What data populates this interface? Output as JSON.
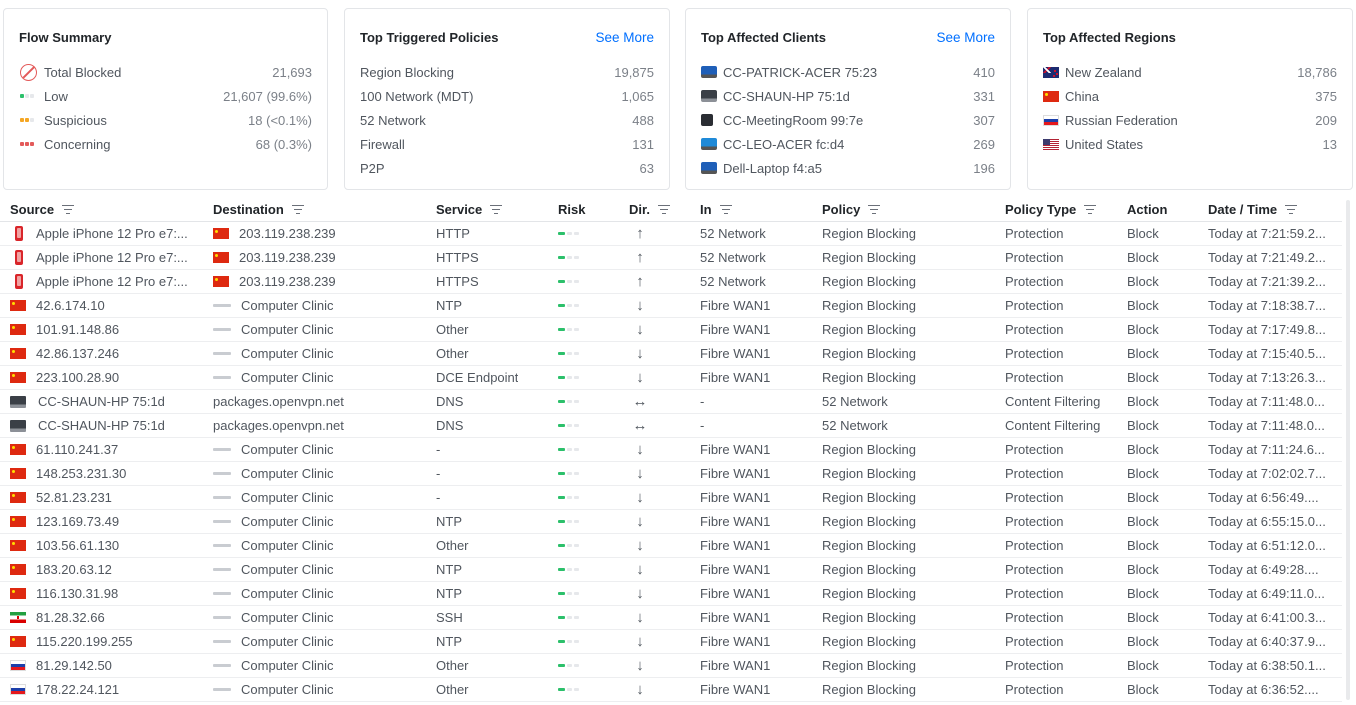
{
  "colors": {
    "accent": "#006fff",
    "low": "#2cc06b",
    "suspicious": "#f5a623",
    "concerning": "#e35a5a"
  },
  "flow_summary": {
    "title": "Flow Summary",
    "rows": [
      {
        "icon": "blocked-icon",
        "label": "Total Blocked",
        "value": "21,693"
      },
      {
        "icon": "low-risk-icon",
        "label": "Low",
        "value": "21,607 (99.6%)"
      },
      {
        "icon": "suspicious-risk-icon",
        "label": "Suspicious",
        "value": "18 (<0.1%)"
      },
      {
        "icon": "concerning-risk-icon",
        "label": "Concerning",
        "value": "68 (0.3%)"
      }
    ]
  },
  "top_policies": {
    "title": "Top Triggered Policies",
    "see_more": "See More",
    "rows": [
      {
        "label": "Region Blocking",
        "value": "19,875"
      },
      {
        "label": "100 Network (MDT)",
        "value": "1,065"
      },
      {
        "label": "52 Network",
        "value": "488"
      },
      {
        "label": "Firewall",
        "value": "131"
      },
      {
        "label": "P2P",
        "value": "63"
      }
    ]
  },
  "top_clients": {
    "title": "Top Affected Clients",
    "see_more": "See More",
    "rows": [
      {
        "icon": "laptop-icon",
        "label": "CC-PATRICK-ACER 75:23",
        "value": "410"
      },
      {
        "icon": "laptop-icon",
        "label": "CC-SHAUN-HP 75:1d",
        "value": "331"
      },
      {
        "icon": "pc-icon",
        "label": "CC-MeetingRoom 99:7e",
        "value": "307"
      },
      {
        "icon": "laptop-icon",
        "label": "CC-LEO-ACER fc:d4",
        "value": "269"
      },
      {
        "icon": "laptop-icon",
        "label": "Dell-Laptop f4:a5",
        "value": "196"
      }
    ]
  },
  "top_regions": {
    "title": "Top Affected Regions",
    "rows": [
      {
        "flag": "nz",
        "label": "New Zealand",
        "value": "18,786"
      },
      {
        "flag": "cn",
        "label": "China",
        "value": "375"
      },
      {
        "flag": "ru",
        "label": "Russian Federation",
        "value": "209"
      },
      {
        "flag": "us",
        "label": "United States",
        "value": "13"
      }
    ]
  },
  "table": {
    "headers": {
      "source": "Source",
      "destination": "Destination",
      "service": "Service",
      "risk": "Risk",
      "dir": "Dir.",
      "in": "In",
      "policy": "Policy",
      "policy_type": "Policy Type",
      "action": "Action",
      "datetime": "Date / Time"
    },
    "rows": [
      {
        "src_icon": "phone",
        "source": "Apple iPhone 12 Pro e7:...",
        "dst_icon": "cn",
        "destination": "203.119.238.239",
        "service": "HTTP",
        "risk": "low",
        "dir": "↑",
        "in": "52 Network",
        "policy": "Region Blocking",
        "policy_type": "Protection",
        "action": "Block",
        "datetime": "Today at 7:21:59.2..."
      },
      {
        "src_icon": "phone",
        "source": "Apple iPhone 12 Pro e7:...",
        "dst_icon": "cn",
        "destination": "203.119.238.239",
        "service": "HTTPS",
        "risk": "low",
        "dir": "↑",
        "in": "52 Network",
        "policy": "Region Blocking",
        "policy_type": "Protection",
        "action": "Block",
        "datetime": "Today at 7:21:49.2..."
      },
      {
        "src_icon": "phone",
        "source": "Apple iPhone 12 Pro e7:...",
        "dst_icon": "cn",
        "destination": "203.119.238.239",
        "service": "HTTPS",
        "risk": "low",
        "dir": "↑",
        "in": "52 Network",
        "policy": "Region Blocking",
        "policy_type": "Protection",
        "action": "Block",
        "datetime": "Today at 7:21:39.2..."
      },
      {
        "src_icon": "cn",
        "source": "42.6.174.10",
        "dst_icon": "router",
        "destination": "Computer Clinic",
        "service": "NTP",
        "risk": "low",
        "dir": "↓",
        "in": "Fibre WAN1",
        "policy": "Region Blocking",
        "policy_type": "Protection",
        "action": "Block",
        "datetime": "Today at 7:18:38.7..."
      },
      {
        "src_icon": "cn",
        "source": "101.91.148.86",
        "dst_icon": "router",
        "destination": "Computer Clinic",
        "service": "Other",
        "risk": "low",
        "dir": "↓",
        "in": "Fibre WAN1",
        "policy": "Region Blocking",
        "policy_type": "Protection",
        "action": "Block",
        "datetime": "Today at 7:17:49.8..."
      },
      {
        "src_icon": "cn",
        "source": "42.86.137.246",
        "dst_icon": "router",
        "destination": "Computer Clinic",
        "service": "Other",
        "risk": "low",
        "dir": "↓",
        "in": "Fibre WAN1",
        "policy": "Region Blocking",
        "policy_type": "Protection",
        "action": "Block",
        "datetime": "Today at 7:15:40.5..."
      },
      {
        "src_icon": "cn",
        "source": "223.100.28.90",
        "dst_icon": "router",
        "destination": "Computer Clinic",
        "service": "DCE Endpoint",
        "risk": "low",
        "dir": "↓",
        "in": "Fibre WAN1",
        "policy": "Region Blocking",
        "policy_type": "Protection",
        "action": "Block",
        "datetime": "Today at 7:13:26.3..."
      },
      {
        "src_icon": "laptop",
        "source": "CC-SHAUN-HP 75:1d",
        "dst_icon": "",
        "destination": "packages.openvpn.net",
        "service": "DNS",
        "risk": "low",
        "dir": "↔",
        "in": "-",
        "policy": "52 Network",
        "policy_type": "Content Filtering",
        "action": "Block",
        "datetime": "Today at 7:11:48.0..."
      },
      {
        "src_icon": "laptop",
        "source": "CC-SHAUN-HP 75:1d",
        "dst_icon": "",
        "destination": "packages.openvpn.net",
        "service": "DNS",
        "risk": "low",
        "dir": "↔",
        "in": "-",
        "policy": "52 Network",
        "policy_type": "Content Filtering",
        "action": "Block",
        "datetime": "Today at 7:11:48.0..."
      },
      {
        "src_icon": "cn",
        "source": "61.110.241.37",
        "dst_icon": "router",
        "destination": "Computer Clinic",
        "service": "-",
        "risk": "low",
        "dir": "↓",
        "in": "Fibre WAN1",
        "policy": "Region Blocking",
        "policy_type": "Protection",
        "action": "Block",
        "datetime": "Today at 7:11:24.6..."
      },
      {
        "src_icon": "cn",
        "source": "148.253.231.30",
        "dst_icon": "router",
        "destination": "Computer Clinic",
        "service": "-",
        "risk": "low",
        "dir": "↓",
        "in": "Fibre WAN1",
        "policy": "Region Blocking",
        "policy_type": "Protection",
        "action": "Block",
        "datetime": "Today at 7:02:02.7..."
      },
      {
        "src_icon": "cn",
        "source": "52.81.23.231",
        "dst_icon": "router",
        "destination": "Computer Clinic",
        "service": "-",
        "risk": "low",
        "dir": "↓",
        "in": "Fibre WAN1",
        "policy": "Region Blocking",
        "policy_type": "Protection",
        "action": "Block",
        "datetime": "Today at 6:56:49...."
      },
      {
        "src_icon": "cn",
        "source": "123.169.73.49",
        "dst_icon": "router",
        "destination": "Computer Clinic",
        "service": "NTP",
        "risk": "low",
        "dir": "↓",
        "in": "Fibre WAN1",
        "policy": "Region Blocking",
        "policy_type": "Protection",
        "action": "Block",
        "datetime": "Today at 6:55:15.0..."
      },
      {
        "src_icon": "cn",
        "source": "103.56.61.130",
        "dst_icon": "router",
        "destination": "Computer Clinic",
        "service": "Other",
        "risk": "low",
        "dir": "↓",
        "in": "Fibre WAN1",
        "policy": "Region Blocking",
        "policy_type": "Protection",
        "action": "Block",
        "datetime": "Today at 6:51:12.0..."
      },
      {
        "src_icon": "cn",
        "source": "183.20.63.12",
        "dst_icon": "router",
        "destination": "Computer Clinic",
        "service": "NTP",
        "risk": "low",
        "dir": "↓",
        "in": "Fibre WAN1",
        "policy": "Region Blocking",
        "policy_type": "Protection",
        "action": "Block",
        "datetime": "Today at 6:49:28...."
      },
      {
        "src_icon": "cn",
        "source": "116.130.31.98",
        "dst_icon": "router",
        "destination": "Computer Clinic",
        "service": "NTP",
        "risk": "low",
        "dir": "↓",
        "in": "Fibre WAN1",
        "policy": "Region Blocking",
        "policy_type": "Protection",
        "action": "Block",
        "datetime": "Today at 6:49:11.0..."
      },
      {
        "src_icon": "ir",
        "source": "81.28.32.66",
        "dst_icon": "router",
        "destination": "Computer Clinic",
        "service": "SSH",
        "risk": "low",
        "dir": "↓",
        "in": "Fibre WAN1",
        "policy": "Region Blocking",
        "policy_type": "Protection",
        "action": "Block",
        "datetime": "Today at 6:41:00.3..."
      },
      {
        "src_icon": "cn",
        "source": "115.220.199.255",
        "dst_icon": "router",
        "destination": "Computer Clinic",
        "service": "NTP",
        "risk": "low",
        "dir": "↓",
        "in": "Fibre WAN1",
        "policy": "Region Blocking",
        "policy_type": "Protection",
        "action": "Block",
        "datetime": "Today at 6:40:37.9..."
      },
      {
        "src_icon": "ru",
        "source": "81.29.142.50",
        "dst_icon": "router",
        "destination": "Computer Clinic",
        "service": "Other",
        "risk": "low",
        "dir": "↓",
        "in": "Fibre WAN1",
        "policy": "Region Blocking",
        "policy_type": "Protection",
        "action": "Block",
        "datetime": "Today at 6:38:50.1..."
      },
      {
        "src_icon": "ru",
        "source": "178.22.24.121",
        "dst_icon": "router",
        "destination": "Computer Clinic",
        "service": "Other",
        "risk": "low",
        "dir": "↓",
        "in": "Fibre WAN1",
        "policy": "Region Blocking",
        "policy_type": "Protection",
        "action": "Block",
        "datetime": "Today at 6:36:52...."
      }
    ]
  }
}
